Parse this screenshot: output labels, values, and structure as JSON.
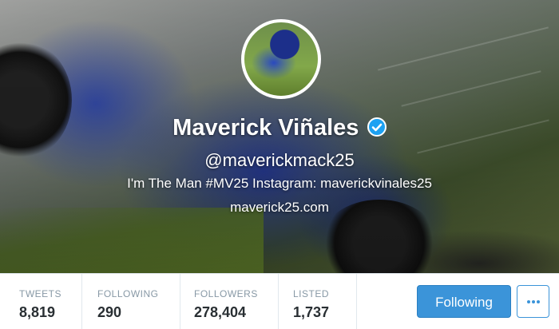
{
  "profile": {
    "name": "Maverick Viñales",
    "handle": "@maverickmack25",
    "bio": "I'm The Man #MV25 Instagram: maverickvinales25",
    "url": "maverick25.com",
    "verified_icon": "verified-badge-icon"
  },
  "stats": [
    {
      "label": "TWEETS",
      "value": "8,819"
    },
    {
      "label": "FOLLOWING",
      "value": "290"
    },
    {
      "label": "FOLLOWERS",
      "value": "278,404"
    },
    {
      "label": "LISTED",
      "value": "1,737"
    }
  ],
  "actions": {
    "follow_label": "Following",
    "more_icon": "more-dots-icon"
  },
  "colors": {
    "accent": "#3b94d9",
    "stat_label": "#8899a6",
    "stat_value": "#292f33"
  }
}
